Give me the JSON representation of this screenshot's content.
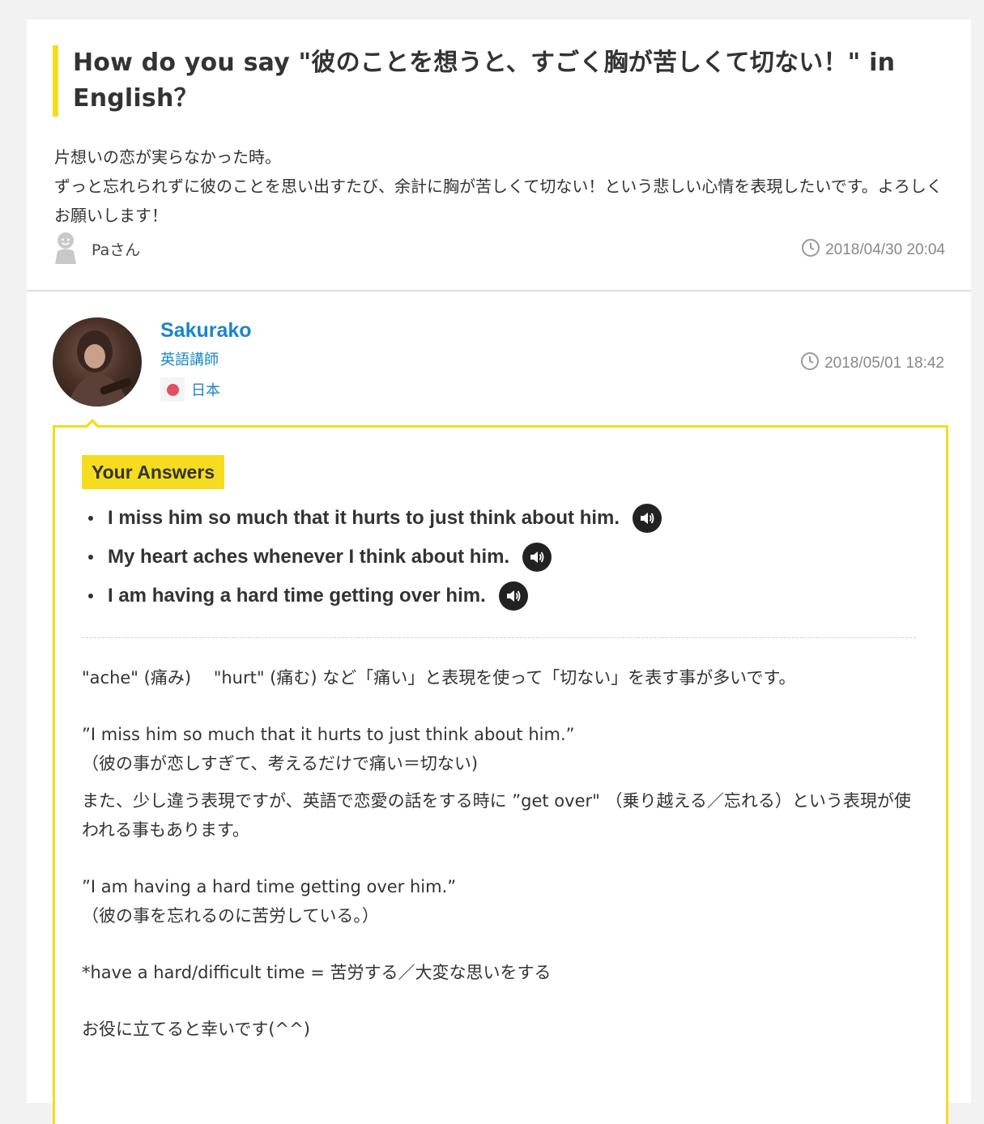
{
  "question": {
    "title": "How do you say \"彼のことを想うと、すごく胸が苦しくて切ない！\" in English？",
    "body": "片想いの恋が実らなかった時。\nずっと忘れられずに彼のことを思い出すたび、余計に胸が苦しくて切ない！という悲しい心情を表現したいです。よろしくお願いします！",
    "asker_name": "Paさん",
    "timestamp": "2018/04/30 20:04"
  },
  "answer": {
    "author_name": "Sakurako",
    "author_role": "英語講師",
    "author_country": "日本",
    "timestamp": "2018/05/01 18:42",
    "section_label": "Your Answers",
    "answers": [
      {
        "text": "I miss him so much that it hurts to just think about him."
      },
      {
        "text": "My heart aches whenever I think about him."
      },
      {
        "text": "I am having a hard time getting over him."
      }
    ],
    "explanation": {
      "p1": "\"ache\" (痛み)　 \"hurt\" (痛む) など「痛い」と表現を使って「切ない」を表す事が多いです。",
      "p2": "”I miss him so much that it hurts to just think about him.”\n（彼の事が恋しすぎて、考えるだけで痛い＝切ない)",
      "p3": "また、少し違う表現ですが、英語で恋愛の話をする時に ”get over\" （乗り越える／忘れる）という表現が使われる事もあります。",
      "p4": "”I am having a hard time getting over him.”\n（彼の事を忘れるのに苦労している。）",
      "p5": "*have a hard/difficult time = 苦労する／大変な思いをする",
      "p6": "お役に立てると幸いです(^^)"
    }
  },
  "colors": {
    "accent_yellow": "#f5dc1f",
    "link_blue": "#1a87c6",
    "flag_red": "#e05060"
  },
  "icons": [
    "person-avatar-icon",
    "clock-icon",
    "speaker-icon",
    "japan-flag-icon"
  ]
}
